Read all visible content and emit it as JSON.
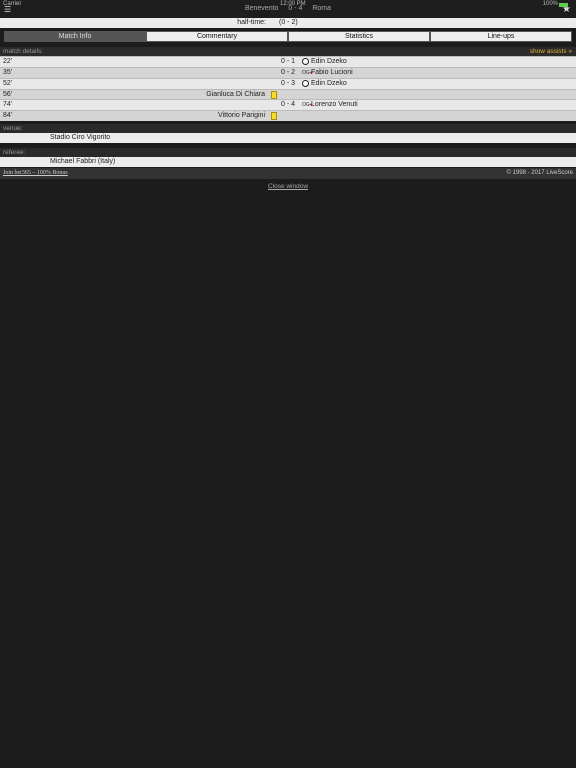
{
  "status": {
    "carrier": "Carrier",
    "time": "12:00 PM",
    "battery": "100%"
  },
  "header": {
    "home": "Benevento",
    "score": "0 - 4",
    "away": "Roma",
    "menu_icon": "menu-icon",
    "star_icon": "star-icon"
  },
  "halftime": {
    "label": "half-time:",
    "value": "(0 - 2)"
  },
  "tabs": [
    "Match Info",
    "Commentary",
    "Statistics",
    "Line-ups"
  ],
  "match_details": {
    "label": "match details:",
    "show_assists": "show assists »"
  },
  "events": [
    {
      "minute": "22'",
      "score": "0 - 1",
      "type": "goal",
      "home": "",
      "away": "Edin Dzeko"
    },
    {
      "minute": "35'",
      "score": "0 - 2",
      "type": "own-goal",
      "home": "",
      "away": "Fabio Lucioni"
    },
    {
      "minute": "52'",
      "score": "0 - 3",
      "type": "goal",
      "home": "",
      "away": "Edin Dzeko"
    },
    {
      "minute": "56'",
      "score": "",
      "type": "yellow-card",
      "home": "Gianluca Di Chiara",
      "away": ""
    },
    {
      "minute": "74'",
      "score": "0 - 4",
      "type": "own-goal",
      "home": "",
      "away": "Lorenzo Venuti"
    },
    {
      "minute": "84'",
      "score": "",
      "type": "yellow-card",
      "home": "Vittorio Parigini",
      "away": ""
    }
  ],
  "venue": {
    "label": "venue:",
    "value": "Stadio Ciro Vigorito"
  },
  "referee": {
    "label": "referee:",
    "value": "Michael Fabbri (Italy)"
  },
  "footer": {
    "link": "Join bet365 – 100% Bonus",
    "copyright": "© 1998 - 2017 LiveScore"
  },
  "close": "Close window"
}
